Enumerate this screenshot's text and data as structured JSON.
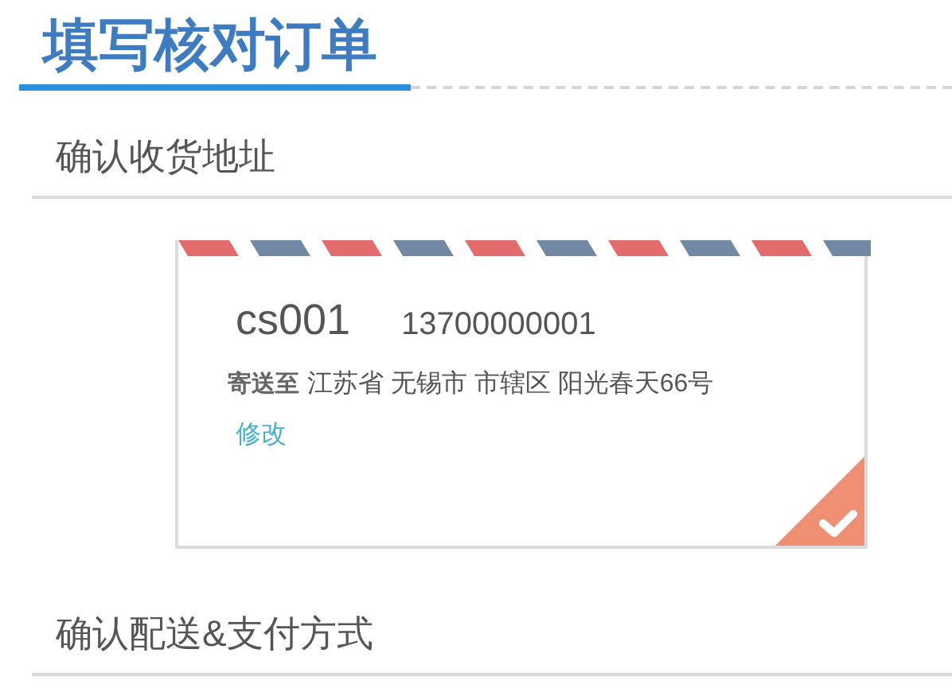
{
  "page_title": "填写核对订单",
  "sections": [
    {
      "title": "确认收货地址"
    },
    {
      "title": "确认配送&支付方式"
    }
  ],
  "address_card": {
    "name": "cs001",
    "phone": "13700000001",
    "label": "寄送至",
    "address": "江苏省 无锡市 市辖区 阳光春天66号",
    "edit_link": "修改",
    "selected": true
  }
}
